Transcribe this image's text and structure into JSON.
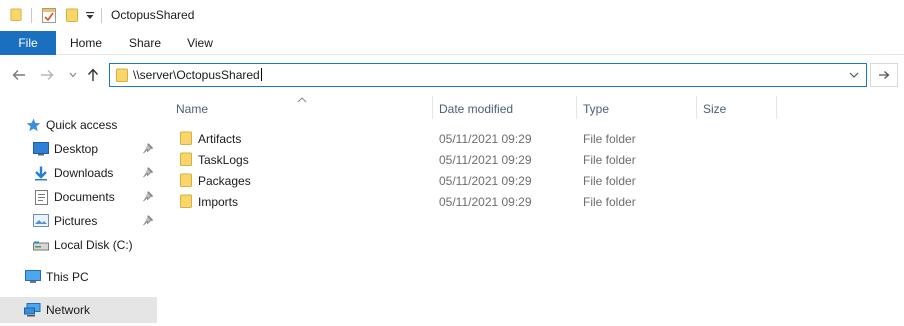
{
  "window": {
    "title": "OctopusShared"
  },
  "ribbon": {
    "tabs": [
      {
        "label": "File"
      },
      {
        "label": "Home"
      },
      {
        "label": "Share"
      },
      {
        "label": "View"
      }
    ]
  },
  "address": {
    "path": "\\\\server\\OctopusShared"
  },
  "nav": {
    "items": [
      {
        "label": "Quick access",
        "icon": "star-icon"
      },
      {
        "label": "Desktop",
        "icon": "desktop-icon",
        "pinned": true
      },
      {
        "label": "Downloads",
        "icon": "download-arrow-icon",
        "pinned": true
      },
      {
        "label": "Documents",
        "icon": "documents-icon",
        "pinned": true
      },
      {
        "label": "Pictures",
        "icon": "pictures-icon",
        "pinned": true
      },
      {
        "label": "Local Disk (C:)",
        "icon": "disk-icon"
      },
      {
        "label": "This PC",
        "icon": "computer-icon"
      },
      {
        "label": "Network",
        "icon": "network-icon",
        "selected": true
      }
    ]
  },
  "columns": {
    "name": "Name",
    "date_modified": "Date modified",
    "type": "Type",
    "size": "Size"
  },
  "files": [
    {
      "name": "Artifacts",
      "date": "05/11/2021 09:29",
      "type": "File folder"
    },
    {
      "name": "TaskLogs",
      "date": "05/11/2021 09:29",
      "type": "File folder"
    },
    {
      "name": "Packages",
      "date": "05/11/2021 09:29",
      "type": "File folder"
    },
    {
      "name": "Imports",
      "date": "05/11/2021 09:29",
      "type": "File folder"
    }
  ],
  "colors": {
    "accent": "#1a6fbf",
    "folder_yellow": "#f8d66a",
    "selection": "#e5e5e5",
    "header_text": "#4c607a"
  }
}
